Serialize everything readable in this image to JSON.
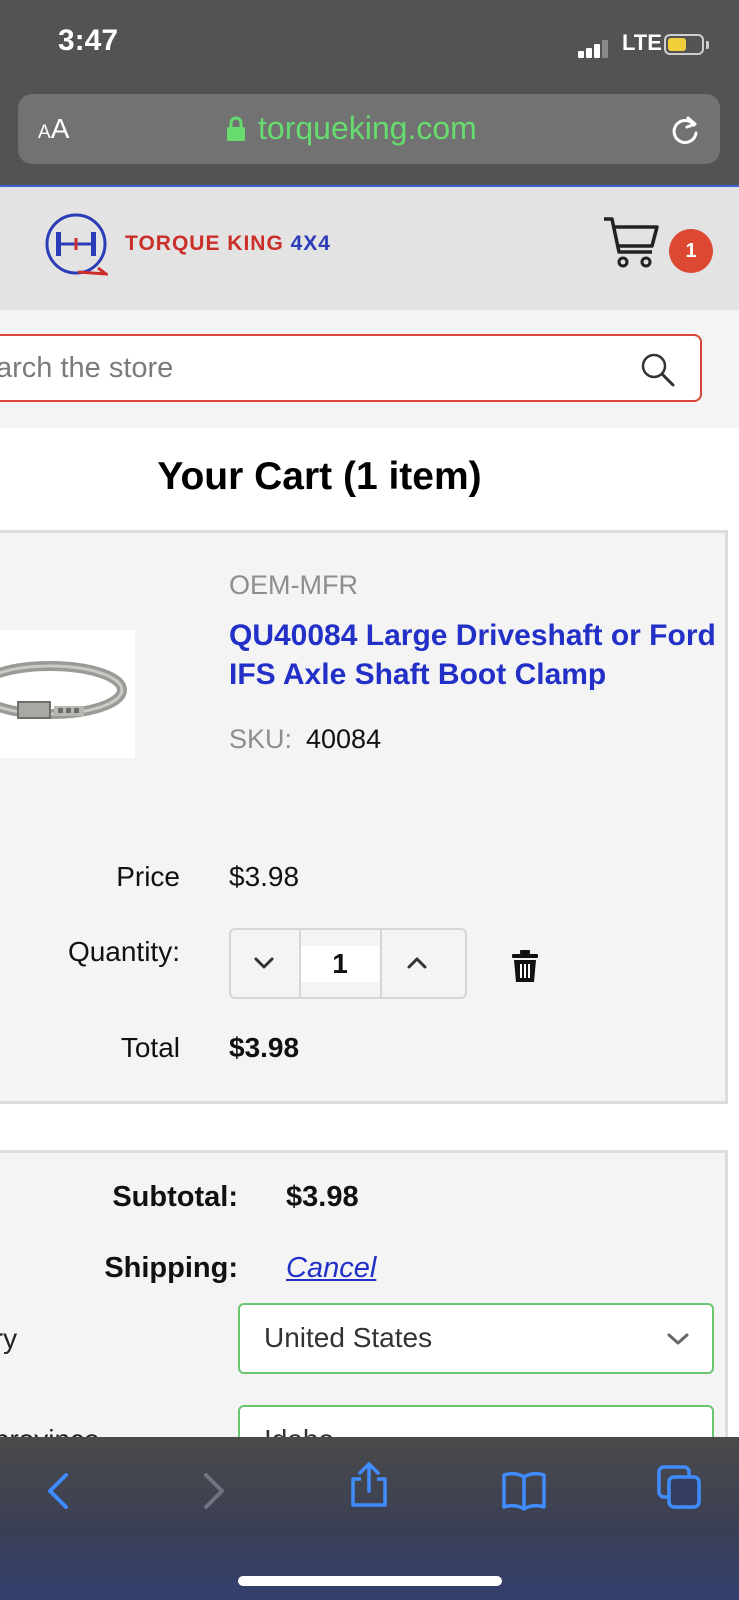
{
  "status_bar": {
    "time": "3:47",
    "network": "LTE"
  },
  "browser": {
    "text_size_label_small": "A",
    "text_size_label_large": "A",
    "domain": "torqueking.com",
    "accent_color": "#67dc6e"
  },
  "site_header": {
    "logo_text_1": "TORQUE KING ",
    "logo_text_2": "4X4",
    "cart_count": "1"
  },
  "search": {
    "placeholder": "arch the store"
  },
  "cart": {
    "title": "Your Cart (1 item)",
    "item": {
      "brand": "OEM-MFR",
      "name": "QU40084 Large Driveshaft or Ford IFS Axle Shaft Boot Clamp",
      "sku_label": "SKU:",
      "sku": "40084",
      "price_label": "Price",
      "price": "$3.98",
      "quantity_label": "Quantity:",
      "quantity": "1",
      "total_label": "Total",
      "total": "$3.98"
    }
  },
  "summary": {
    "subtotal_label": "Subtotal:",
    "subtotal": "$3.98",
    "shipping_label": "Shipping:",
    "shipping_action": "Cancel",
    "country_label": "try",
    "country_value": "United States",
    "province_label": "/province",
    "province_value": "Idaho"
  },
  "toolbar": {
    "icons": [
      "back-icon",
      "forward-icon",
      "share-icon",
      "bookmarks-icon",
      "tabs-icon"
    ]
  }
}
